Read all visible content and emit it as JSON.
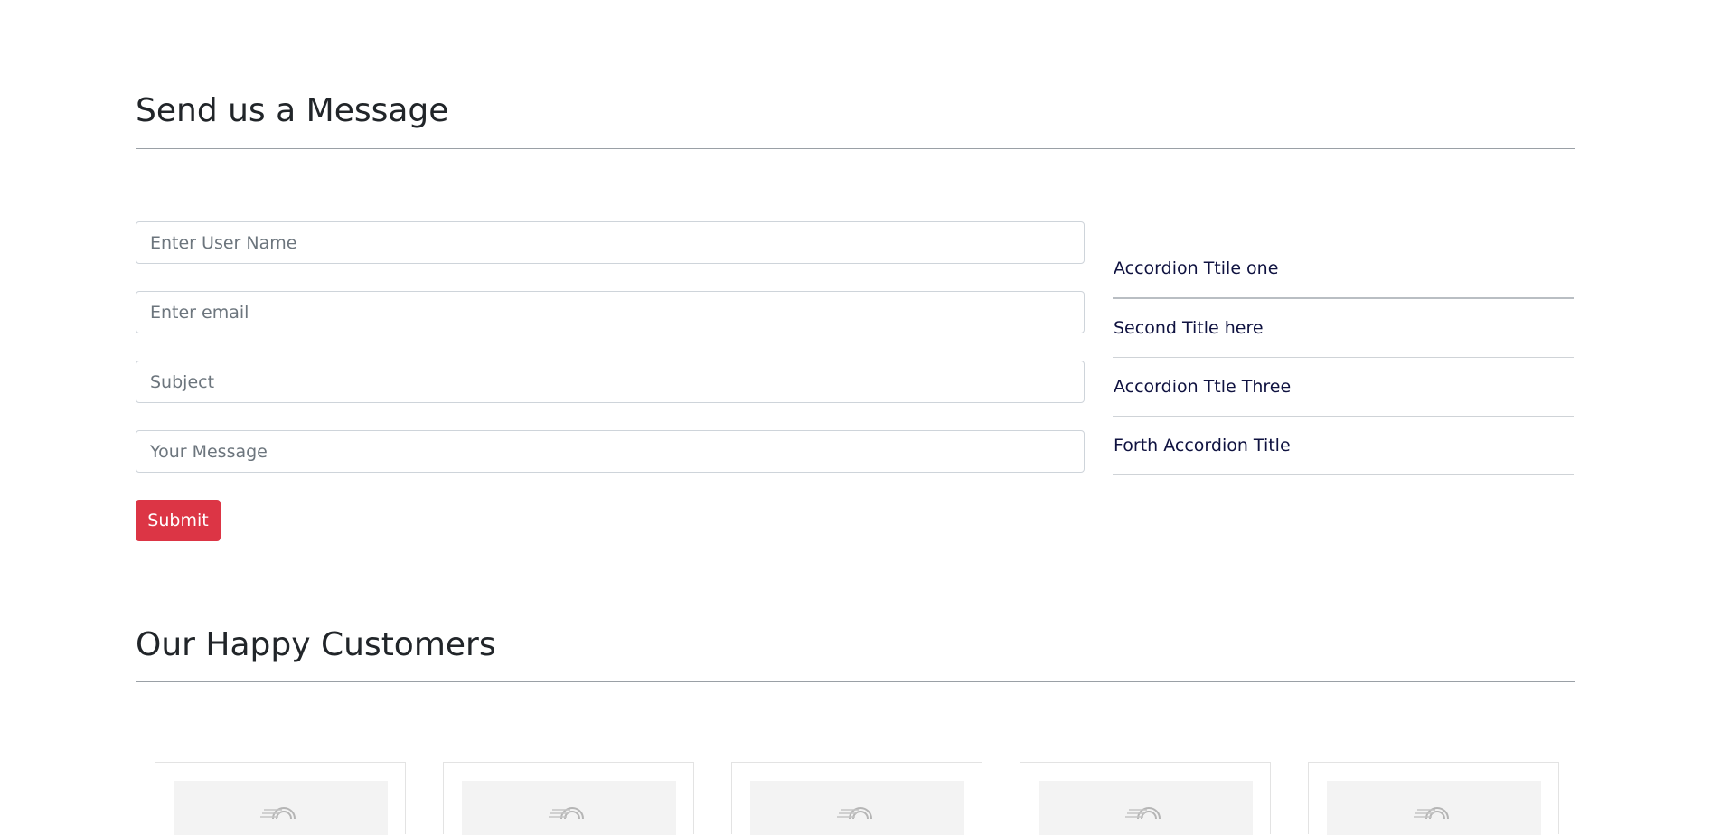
{
  "contact": {
    "title": "Send us a Message",
    "fields": {
      "username_placeholder": "Enter User Name",
      "email_placeholder": "Enter email",
      "subject_placeholder": "Subject",
      "message_placeholder": "Your Message"
    },
    "submit_label": "Submit",
    "accent": "#dc3545"
  },
  "accordion": {
    "items": [
      {
        "label": "Accordion Ttile one"
      },
      {
        "label": "Second Title here"
      },
      {
        "label": "Accordion Ttle Three"
      },
      {
        "label": "Forth Accordion Title"
      }
    ]
  },
  "customers": {
    "title": "Our Happy Customers",
    "cards": [
      {
        "icon": "placeholder-image-icon"
      },
      {
        "icon": "placeholder-image-icon"
      },
      {
        "icon": "placeholder-image-icon"
      },
      {
        "icon": "placeholder-image-icon"
      },
      {
        "icon": "placeholder-image-icon"
      }
    ]
  }
}
